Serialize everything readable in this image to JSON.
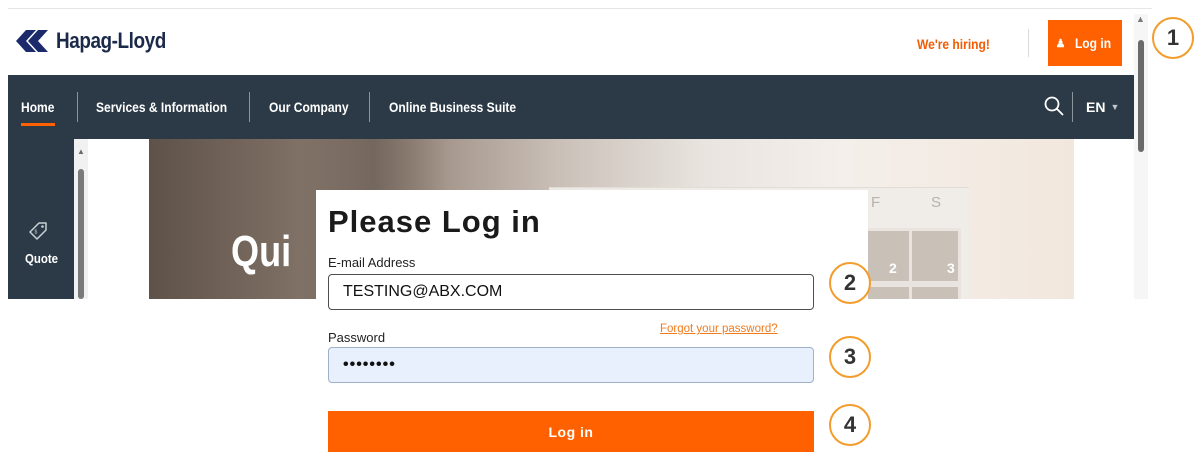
{
  "header": {
    "brand": "Hapag-Lloyd",
    "hiring_link": "We're hiring!",
    "login_button": "Log in"
  },
  "nav": {
    "items": [
      {
        "label": "Home",
        "active": true
      },
      {
        "label": "Services & Information"
      },
      {
        "label": "Our Company"
      },
      {
        "label": "Online Business Suite"
      }
    ],
    "language": "EN"
  },
  "sidebar": {
    "quote_label": "Quote"
  },
  "hero": {
    "heading_partial": "Qui",
    "calendar_headers": [
      "F",
      "S"
    ],
    "calendar_numbers": [
      "2",
      "3"
    ]
  },
  "login_form": {
    "title": "Please Log in",
    "email_label": "E-mail Address",
    "email_value": "TESTING@ABX.COM",
    "password_label": "Password",
    "password_value": "••••••••",
    "forgot_link": "Forgot your password?",
    "submit_label": "Log in"
  },
  "steps": {
    "s1": "1",
    "s2": "2",
    "s3": "3",
    "s4": "4"
  },
  "colors": {
    "brand_orange": "#ff6100",
    "nav_dark": "#2c3a47",
    "marker_ring": "#f39c2b"
  }
}
